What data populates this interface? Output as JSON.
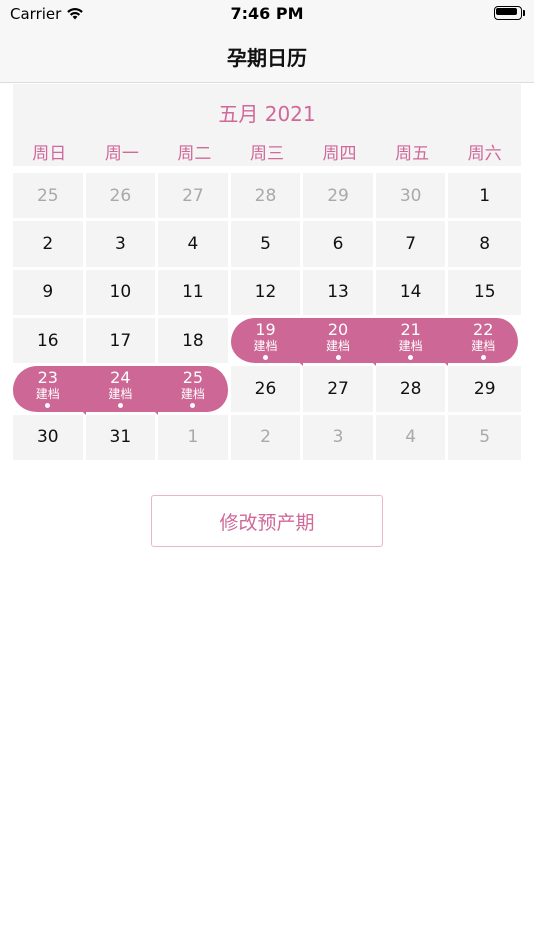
{
  "status_bar": {
    "carrier": "Carrier",
    "time": "7:46 PM",
    "wifi_icon": "wifi-icon",
    "battery_icon": "battery-icon"
  },
  "nav": {
    "title": "孕期日历"
  },
  "calendar": {
    "month_title": "五月 2021",
    "weekdays": [
      "周日",
      "周一",
      "周二",
      "周三",
      "周四",
      "周五",
      "周六"
    ],
    "highlight_color": "#cd6796",
    "accent_color": "#d0689a",
    "weeks": [
      [
        {
          "day": "25",
          "muted": true
        },
        {
          "day": "26",
          "muted": true
        },
        {
          "day": "27",
          "muted": true
        },
        {
          "day": "28",
          "muted": true
        },
        {
          "day": "29",
          "muted": true
        },
        {
          "day": "30",
          "muted": true
        },
        {
          "day": "1"
        }
      ],
      [
        {
          "day": "2"
        },
        {
          "day": "3"
        },
        {
          "day": "4"
        },
        {
          "day": "5"
        },
        {
          "day": "6"
        },
        {
          "day": "7"
        },
        {
          "day": "8"
        }
      ],
      [
        {
          "day": "9"
        },
        {
          "day": "10"
        },
        {
          "day": "11"
        },
        {
          "day": "12"
        },
        {
          "day": "13"
        },
        {
          "day": "14"
        },
        {
          "day": "15"
        }
      ],
      [
        {
          "day": "16"
        },
        {
          "day": "17"
        },
        {
          "day": "18"
        },
        {
          "day": "19",
          "label": "建档",
          "highlight": true,
          "dot": true
        },
        {
          "day": "20",
          "label": "建档",
          "highlight": true,
          "dot": true
        },
        {
          "day": "21",
          "label": "建档",
          "highlight": true,
          "dot": true
        },
        {
          "day": "22",
          "label": "建档",
          "highlight": true,
          "dot": true
        }
      ],
      [
        {
          "day": "23",
          "label": "建档",
          "highlight": true,
          "dot": true
        },
        {
          "day": "24",
          "label": "建档",
          "highlight": true,
          "dot": true
        },
        {
          "day": "25",
          "label": "建档",
          "highlight": true,
          "dot": true
        },
        {
          "day": "26"
        },
        {
          "day": "27"
        },
        {
          "day": "28"
        },
        {
          "day": "29"
        }
      ],
      [
        {
          "day": "30"
        },
        {
          "day": "31"
        },
        {
          "day": "1",
          "muted": true
        },
        {
          "day": "2",
          "muted": true
        },
        {
          "day": "3",
          "muted": true
        },
        {
          "day": "4",
          "muted": true
        },
        {
          "day": "5",
          "muted": true
        }
      ]
    ]
  },
  "actions": {
    "edit_due_date": "修改预产期"
  }
}
